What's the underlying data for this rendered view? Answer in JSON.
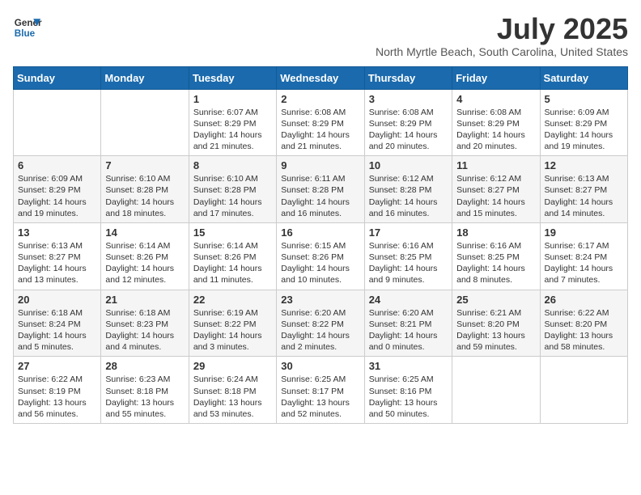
{
  "header": {
    "logo_line1": "General",
    "logo_line2": "Blue",
    "month_year": "July 2025",
    "location": "North Myrtle Beach, South Carolina, United States"
  },
  "days_of_week": [
    "Sunday",
    "Monday",
    "Tuesday",
    "Wednesday",
    "Thursday",
    "Friday",
    "Saturday"
  ],
  "weeks": [
    [
      {
        "day": "",
        "sunrise": "",
        "sunset": "",
        "daylight": ""
      },
      {
        "day": "",
        "sunrise": "",
        "sunset": "",
        "daylight": ""
      },
      {
        "day": "1",
        "sunrise": "Sunrise: 6:07 AM",
        "sunset": "Sunset: 8:29 PM",
        "daylight": "Daylight: 14 hours and 21 minutes."
      },
      {
        "day": "2",
        "sunrise": "Sunrise: 6:08 AM",
        "sunset": "Sunset: 8:29 PM",
        "daylight": "Daylight: 14 hours and 21 minutes."
      },
      {
        "day": "3",
        "sunrise": "Sunrise: 6:08 AM",
        "sunset": "Sunset: 8:29 PM",
        "daylight": "Daylight: 14 hours and 20 minutes."
      },
      {
        "day": "4",
        "sunrise": "Sunrise: 6:08 AM",
        "sunset": "Sunset: 8:29 PM",
        "daylight": "Daylight: 14 hours and 20 minutes."
      },
      {
        "day": "5",
        "sunrise": "Sunrise: 6:09 AM",
        "sunset": "Sunset: 8:29 PM",
        "daylight": "Daylight: 14 hours and 19 minutes."
      }
    ],
    [
      {
        "day": "6",
        "sunrise": "Sunrise: 6:09 AM",
        "sunset": "Sunset: 8:29 PM",
        "daylight": "Daylight: 14 hours and 19 minutes."
      },
      {
        "day": "7",
        "sunrise": "Sunrise: 6:10 AM",
        "sunset": "Sunset: 8:28 PM",
        "daylight": "Daylight: 14 hours and 18 minutes."
      },
      {
        "day": "8",
        "sunrise": "Sunrise: 6:10 AM",
        "sunset": "Sunset: 8:28 PM",
        "daylight": "Daylight: 14 hours and 17 minutes."
      },
      {
        "day": "9",
        "sunrise": "Sunrise: 6:11 AM",
        "sunset": "Sunset: 8:28 PM",
        "daylight": "Daylight: 14 hours and 16 minutes."
      },
      {
        "day": "10",
        "sunrise": "Sunrise: 6:12 AM",
        "sunset": "Sunset: 8:28 PM",
        "daylight": "Daylight: 14 hours and 16 minutes."
      },
      {
        "day": "11",
        "sunrise": "Sunrise: 6:12 AM",
        "sunset": "Sunset: 8:27 PM",
        "daylight": "Daylight: 14 hours and 15 minutes."
      },
      {
        "day": "12",
        "sunrise": "Sunrise: 6:13 AM",
        "sunset": "Sunset: 8:27 PM",
        "daylight": "Daylight: 14 hours and 14 minutes."
      }
    ],
    [
      {
        "day": "13",
        "sunrise": "Sunrise: 6:13 AM",
        "sunset": "Sunset: 8:27 PM",
        "daylight": "Daylight: 14 hours and 13 minutes."
      },
      {
        "day": "14",
        "sunrise": "Sunrise: 6:14 AM",
        "sunset": "Sunset: 8:26 PM",
        "daylight": "Daylight: 14 hours and 12 minutes."
      },
      {
        "day": "15",
        "sunrise": "Sunrise: 6:14 AM",
        "sunset": "Sunset: 8:26 PM",
        "daylight": "Daylight: 14 hours and 11 minutes."
      },
      {
        "day": "16",
        "sunrise": "Sunrise: 6:15 AM",
        "sunset": "Sunset: 8:26 PM",
        "daylight": "Daylight: 14 hours and 10 minutes."
      },
      {
        "day": "17",
        "sunrise": "Sunrise: 6:16 AM",
        "sunset": "Sunset: 8:25 PM",
        "daylight": "Daylight: 14 hours and 9 minutes."
      },
      {
        "day": "18",
        "sunrise": "Sunrise: 6:16 AM",
        "sunset": "Sunset: 8:25 PM",
        "daylight": "Daylight: 14 hours and 8 minutes."
      },
      {
        "day": "19",
        "sunrise": "Sunrise: 6:17 AM",
        "sunset": "Sunset: 8:24 PM",
        "daylight": "Daylight: 14 hours and 7 minutes."
      }
    ],
    [
      {
        "day": "20",
        "sunrise": "Sunrise: 6:18 AM",
        "sunset": "Sunset: 8:24 PM",
        "daylight": "Daylight: 14 hours and 5 minutes."
      },
      {
        "day": "21",
        "sunrise": "Sunrise: 6:18 AM",
        "sunset": "Sunset: 8:23 PM",
        "daylight": "Daylight: 14 hours and 4 minutes."
      },
      {
        "day": "22",
        "sunrise": "Sunrise: 6:19 AM",
        "sunset": "Sunset: 8:22 PM",
        "daylight": "Daylight: 14 hours and 3 minutes."
      },
      {
        "day": "23",
        "sunrise": "Sunrise: 6:20 AM",
        "sunset": "Sunset: 8:22 PM",
        "daylight": "Daylight: 14 hours and 2 minutes."
      },
      {
        "day": "24",
        "sunrise": "Sunrise: 6:20 AM",
        "sunset": "Sunset: 8:21 PM",
        "daylight": "Daylight: 14 hours and 0 minutes."
      },
      {
        "day": "25",
        "sunrise": "Sunrise: 6:21 AM",
        "sunset": "Sunset: 8:20 PM",
        "daylight": "Daylight: 13 hours and 59 minutes."
      },
      {
        "day": "26",
        "sunrise": "Sunrise: 6:22 AM",
        "sunset": "Sunset: 8:20 PM",
        "daylight": "Daylight: 13 hours and 58 minutes."
      }
    ],
    [
      {
        "day": "27",
        "sunrise": "Sunrise: 6:22 AM",
        "sunset": "Sunset: 8:19 PM",
        "daylight": "Daylight: 13 hours and 56 minutes."
      },
      {
        "day": "28",
        "sunrise": "Sunrise: 6:23 AM",
        "sunset": "Sunset: 8:18 PM",
        "daylight": "Daylight: 13 hours and 55 minutes."
      },
      {
        "day": "29",
        "sunrise": "Sunrise: 6:24 AM",
        "sunset": "Sunset: 8:18 PM",
        "daylight": "Daylight: 13 hours and 53 minutes."
      },
      {
        "day": "30",
        "sunrise": "Sunrise: 6:25 AM",
        "sunset": "Sunset: 8:17 PM",
        "daylight": "Daylight: 13 hours and 52 minutes."
      },
      {
        "day": "31",
        "sunrise": "Sunrise: 6:25 AM",
        "sunset": "Sunset: 8:16 PM",
        "daylight": "Daylight: 13 hours and 50 minutes."
      },
      {
        "day": "",
        "sunrise": "",
        "sunset": "",
        "daylight": ""
      },
      {
        "day": "",
        "sunrise": "",
        "sunset": "",
        "daylight": ""
      }
    ]
  ]
}
